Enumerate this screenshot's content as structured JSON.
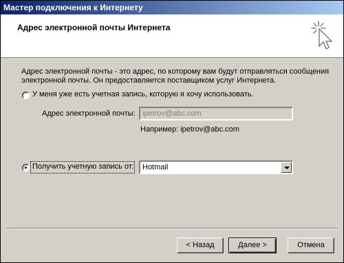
{
  "window": {
    "title": "Мастер подключения к Интернету"
  },
  "header": {
    "title": "Адрес электронной почты Интернета"
  },
  "description": "Адрес электронной почты - это адрес, по которому вам будут отправляться сообщения электронной почты. Он предоставляется поставщиком услуг Интернета.",
  "option_existing": {
    "label": "У меня уже есть учетная запись, которую я хочу использовать.",
    "selected": false,
    "email_label": "Адрес электронной почты:",
    "email_value": "ipetrov@abc.com",
    "example": "Например: ipetrov@abc.com"
  },
  "option_new": {
    "label": "Получить учетную запись от:",
    "selected": true,
    "provider": "Hotmail"
  },
  "buttons": {
    "back": "< Назад",
    "next": "Далее >",
    "cancel": "Отмена"
  }
}
